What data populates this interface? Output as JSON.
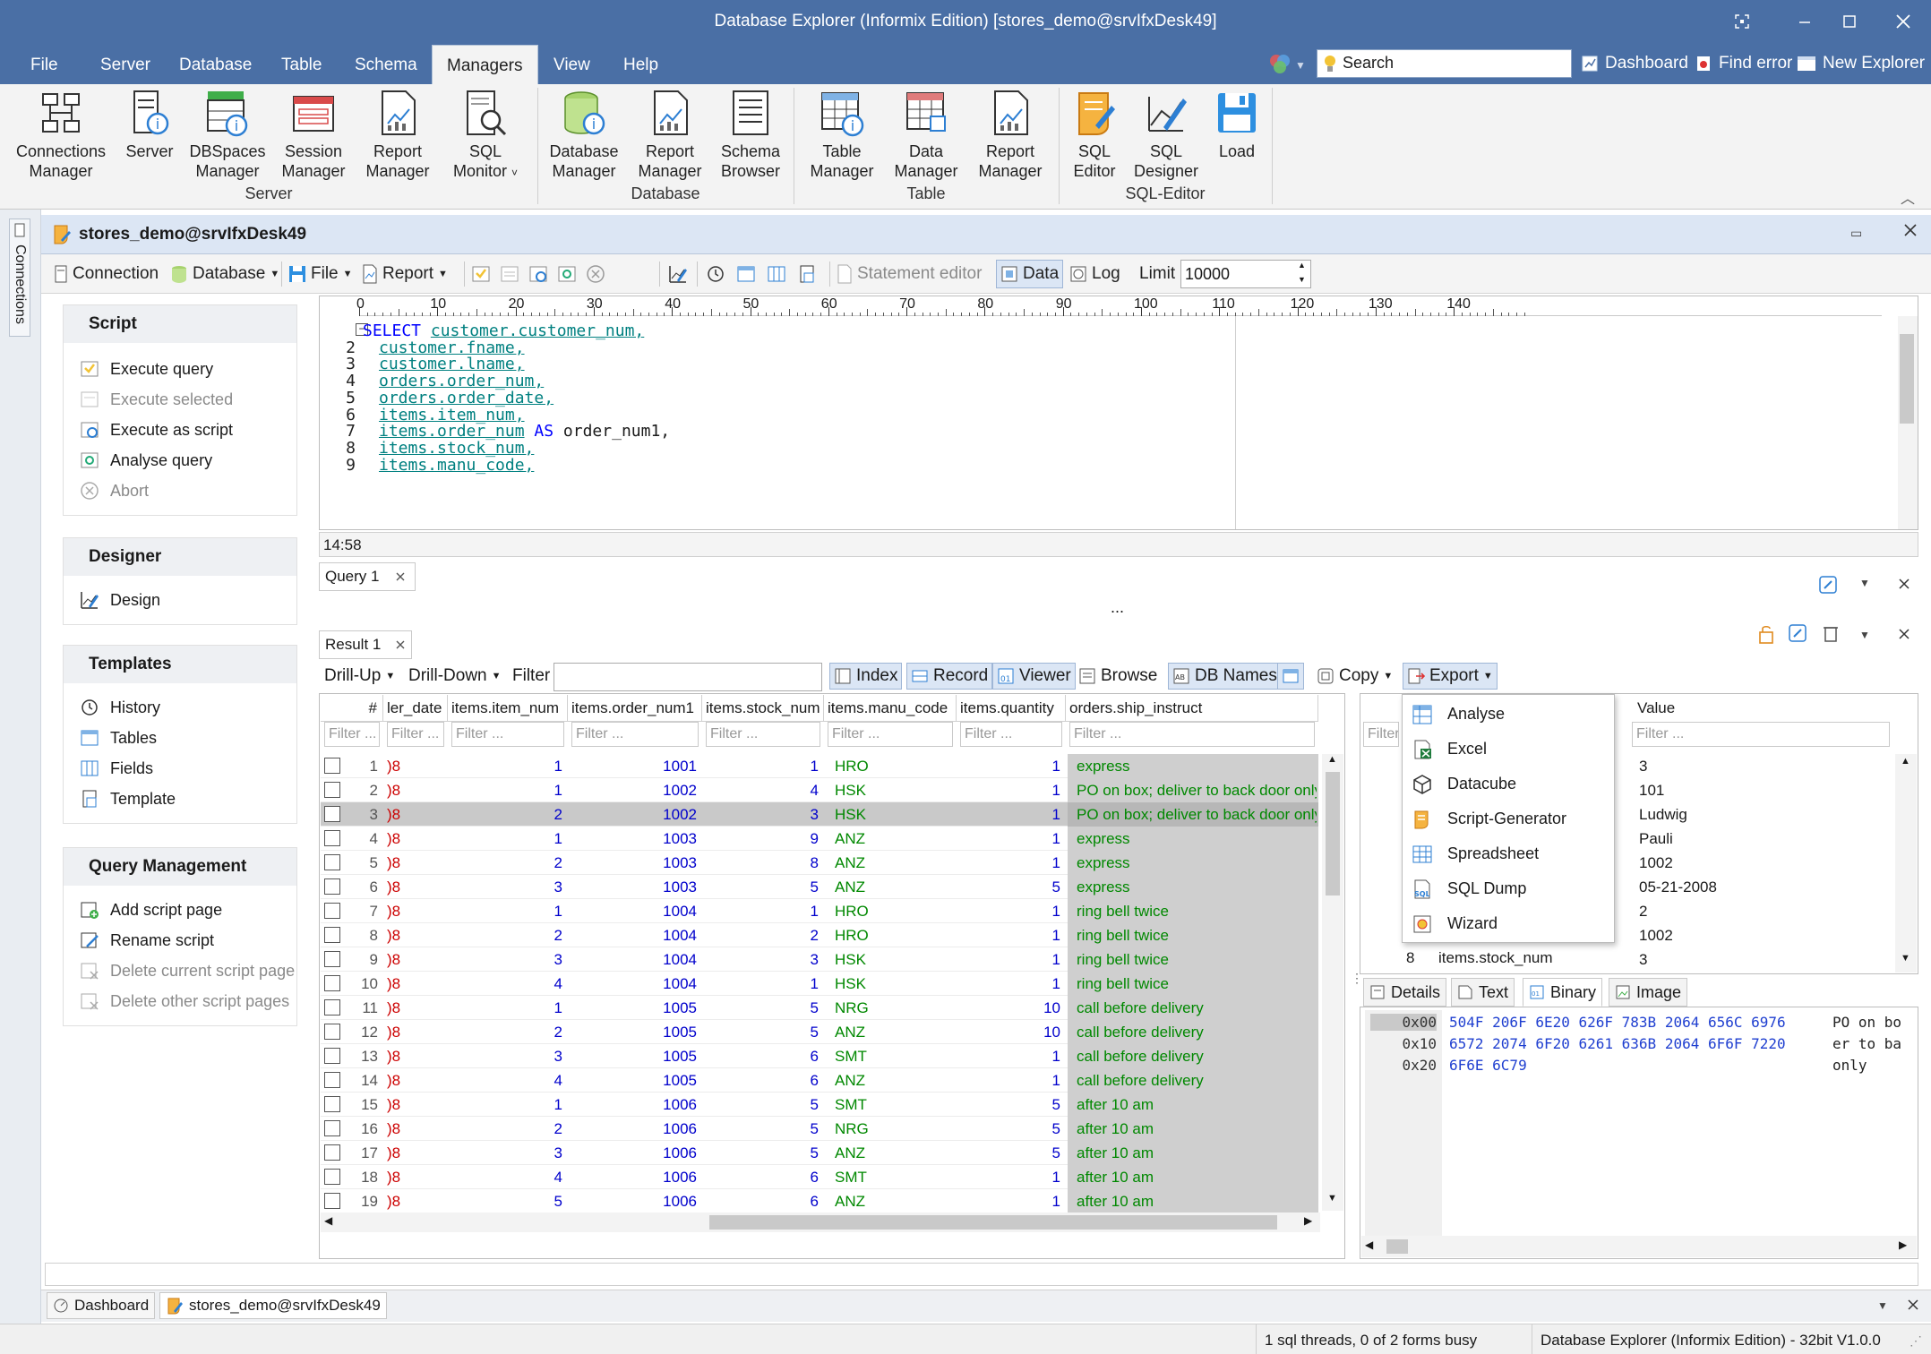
{
  "app": {
    "title": "Database Explorer (Informix Edition) [stores_demo@srvIfxDesk49]"
  },
  "menu": [
    "File",
    "Server",
    "Database",
    "Table",
    "Schema",
    "Managers",
    "View",
    "Help"
  ],
  "quick": {
    "search_placeholder": "Search",
    "dashboard": "Dashboard",
    "find_error": "Find error",
    "new_explorer": "New Explorer"
  },
  "ribbon": {
    "buttons": [
      {
        "l1": "Connections",
        "l2": "Manager",
        "icon": "connections-manager-icon"
      },
      {
        "l1": "Server",
        "l2": "",
        "icon": "server-icon"
      },
      {
        "l1": "DBSpaces",
        "l2": "Manager",
        "icon": "dbspaces-icon"
      },
      {
        "l1": "Session",
        "l2": "Manager",
        "icon": "session-icon"
      },
      {
        "l1": "Report",
        "l2": "Manager",
        "icon": "report-icon"
      },
      {
        "l1": "SQL",
        "l2": "Monitor",
        "icon": "sql-monitor-icon"
      },
      {
        "l1": "Database",
        "l2": "Manager",
        "icon": "database-icon"
      },
      {
        "l1": "Report",
        "l2": "Manager",
        "icon": "report-icon"
      },
      {
        "l1": "Schema",
        "l2": "Browser",
        "icon": "schema-browser-icon"
      },
      {
        "l1": "Table",
        "l2": "Manager",
        "icon": "table-manager-icon"
      },
      {
        "l1": "Data",
        "l2": "Manager",
        "icon": "data-manager-icon"
      },
      {
        "l1": "Report",
        "l2": "Manager",
        "icon": "report-icon"
      },
      {
        "l1": "SQL",
        "l2": "Editor",
        "icon": "sql-editor-icon"
      },
      {
        "l1": "SQL",
        "l2": "Designer",
        "icon": "sql-designer-icon"
      },
      {
        "l1": "Load",
        "l2": "",
        "icon": "load-icon"
      }
    ],
    "groups": [
      "Server",
      "Database",
      "Table",
      "SQL-Editor"
    ]
  },
  "left_strip": "Connections",
  "doc": {
    "title": "stores_demo@srvIfxDesk49"
  },
  "toolbar": {
    "connection": "Connection",
    "database": "Database",
    "file": "File",
    "report": "Report",
    "statement_editor": "Statement editor",
    "data": "Data",
    "log": "Log",
    "limit_label": "Limit",
    "limit_value": "10000"
  },
  "panels": {
    "script": {
      "title": "Script",
      "items": [
        "Execute query",
        "Execute selected",
        "Execute as script",
        "Analyse query",
        "Abort"
      ]
    },
    "designer": {
      "title": "Designer",
      "items": [
        "Design"
      ]
    },
    "templates": {
      "title": "Templates",
      "items": [
        "History",
        "Tables",
        "Fields",
        "Template"
      ]
    },
    "query_mgmt": {
      "title": "Query Management",
      "items": [
        "Add script page",
        "Rename script",
        "Delete current script page",
        "Delete other script pages"
      ]
    }
  },
  "editor": {
    "ruler": [
      "0",
      "10",
      "20",
      "30",
      "40",
      "50",
      "60",
      "70",
      "80",
      "90",
      "100",
      "110",
      "120",
      "130",
      "140"
    ],
    "lines": [
      {
        "n": "",
        "kw": "SELECT ",
        "rest": "customer.customer_num,"
      },
      {
        "n": "2",
        "kw": "",
        "rest": "customer.fname,"
      },
      {
        "n": "3",
        "kw": "",
        "rest": "customer.lname,"
      },
      {
        "n": "4",
        "kw": "",
        "rest": "orders.order_num,"
      },
      {
        "n": "5",
        "kw": "",
        "rest": "orders.order_date,"
      },
      {
        "n": "6",
        "kw": "",
        "rest": "items.item_num,"
      },
      {
        "n": "7",
        "kw": "",
        "rest": "items.order_num",
        "as": " AS ",
        "alias": "order_num1,"
      },
      {
        "n": "8",
        "kw": "",
        "rest": "items.stock_num,"
      },
      {
        "n": "9",
        "kw": "",
        "rest": "items.manu_code,"
      }
    ],
    "cursor": "14:58"
  },
  "tabs": {
    "query": "Query 1",
    "result": "Result 1",
    "ellipsis": "..."
  },
  "grid_toolbar": {
    "drill_up": "Drill-Up",
    "drill_down": "Drill-Down",
    "filter": "Filter",
    "index": "Index",
    "record": "Record",
    "viewer": "Viewer",
    "browse": "Browse",
    "db_names": "DB Names",
    "copy": "Copy",
    "export": "Export"
  },
  "grid": {
    "columns": [
      "#",
      "ler_date",
      "items.item_num",
      "items.order_num1",
      "items.stock_num",
      "items.manu_code",
      "items.quantity",
      "orders.ship_instruct"
    ],
    "filter_placeholder": "Filter ...",
    "rows": [
      {
        "n": "1",
        "d": ")8",
        "item": "1",
        "order": "1001",
        "stock": "1",
        "manu": "HRO",
        "qty": "1",
        "ship": "express"
      },
      {
        "n": "2",
        "d": ")8",
        "item": "1",
        "order": "1002",
        "stock": "4",
        "manu": "HSK",
        "qty": "1",
        "ship": "PO on box; deliver to back door only"
      },
      {
        "n": "3",
        "d": ")8",
        "item": "2",
        "order": "1002",
        "stock": "3",
        "manu": "HSK",
        "qty": "1",
        "ship": "PO on box; deliver to back door only"
      },
      {
        "n": "4",
        "d": ")8",
        "item": "1",
        "order": "1003",
        "stock": "9",
        "manu": "ANZ",
        "qty": "1",
        "ship": "express"
      },
      {
        "n": "5",
        "d": ")8",
        "item": "2",
        "order": "1003",
        "stock": "8",
        "manu": "ANZ",
        "qty": "1",
        "ship": "express"
      },
      {
        "n": "6",
        "d": ")8",
        "item": "3",
        "order": "1003",
        "stock": "5",
        "manu": "ANZ",
        "qty": "5",
        "ship": "express"
      },
      {
        "n": "7",
        "d": ")8",
        "item": "1",
        "order": "1004",
        "stock": "1",
        "manu": "HRO",
        "qty": "1",
        "ship": "ring bell twice"
      },
      {
        "n": "8",
        "d": ")8",
        "item": "2",
        "order": "1004",
        "stock": "2",
        "manu": "HRO",
        "qty": "1",
        "ship": "ring bell twice"
      },
      {
        "n": "9",
        "d": ")8",
        "item": "3",
        "order": "1004",
        "stock": "3",
        "manu": "HSK",
        "qty": "1",
        "ship": "ring bell twice"
      },
      {
        "n": "10",
        "d": ")8",
        "item": "4",
        "order": "1004",
        "stock": "1",
        "manu": "HSK",
        "qty": "1",
        "ship": "ring bell twice"
      },
      {
        "n": "11",
        "d": ")8",
        "item": "1",
        "order": "1005",
        "stock": "5",
        "manu": "NRG",
        "qty": "10",
        "ship": "call before delivery"
      },
      {
        "n": "12",
        "d": ")8",
        "item": "2",
        "order": "1005",
        "stock": "5",
        "manu": "ANZ",
        "qty": "10",
        "ship": "call before delivery"
      },
      {
        "n": "13",
        "d": ")8",
        "item": "3",
        "order": "1005",
        "stock": "6",
        "manu": "SMT",
        "qty": "1",
        "ship": "call before delivery"
      },
      {
        "n": "14",
        "d": ")8",
        "item": "4",
        "order": "1005",
        "stock": "6",
        "manu": "ANZ",
        "qty": "1",
        "ship": "call before delivery"
      },
      {
        "n": "15",
        "d": ")8",
        "item": "1",
        "order": "1006",
        "stock": "5",
        "manu": "SMT",
        "qty": "5",
        "ship": "after 10 am"
      },
      {
        "n": "16",
        "d": ")8",
        "item": "2",
        "order": "1006",
        "stock": "5",
        "manu": "NRG",
        "qty": "5",
        "ship": "after 10 am"
      },
      {
        "n": "17",
        "d": ")8",
        "item": "3",
        "order": "1006",
        "stock": "5",
        "manu": "ANZ",
        "qty": "5",
        "ship": "after 10 am"
      },
      {
        "n": "18",
        "d": ")8",
        "item": "4",
        "order": "1006",
        "stock": "6",
        "manu": "SMT",
        "qty": "1",
        "ship": "after 10 am"
      },
      {
        "n": "19",
        "d": ")8",
        "item": "5",
        "order": "1006",
        "stock": "6",
        "manu": "ANZ",
        "qty": "1",
        "ship": "after 10 am"
      }
    ]
  },
  "export_menu": [
    "Analyse",
    "Excel",
    "Datacube",
    "Script-Generator",
    "Spreadsheet",
    "SQL Dump",
    "Wizard"
  ],
  "record_panel": {
    "value_header": "Value",
    "filter_placeholder": "Filter ...",
    "filter_short": "Filter",
    "values": [
      "3",
      "101",
      "Ludwig",
      "Pauli",
      "1002",
      "05-21-2008",
      "2",
      "1002",
      "3"
    ],
    "last_row_num": "8",
    "last_row_field": "items.stock_num"
  },
  "detail_tabs": [
    "Details",
    "Text",
    "Binary",
    "Image"
  ],
  "hex": {
    "offsets": [
      "0x00",
      "0x10",
      "0x20"
    ],
    "bytes": [
      "504F 206F 6E20 626F 783B 2064 656C 6976",
      "6572 2074 6F20 6261 636B 2064 6F6F 7220",
      "6F6E 6C79"
    ],
    "ascii": [
      "PO on bo",
      "er to ba",
      "only"
    ]
  },
  "bottom_tabs": [
    "Dashboard",
    "stores_demo@srvIfxDesk49"
  ],
  "status": {
    "threads": "1 sql threads, 0 of 2 forms busy",
    "app": "Database Explorer (Informix Edition) - 32bit V1.0.0"
  }
}
